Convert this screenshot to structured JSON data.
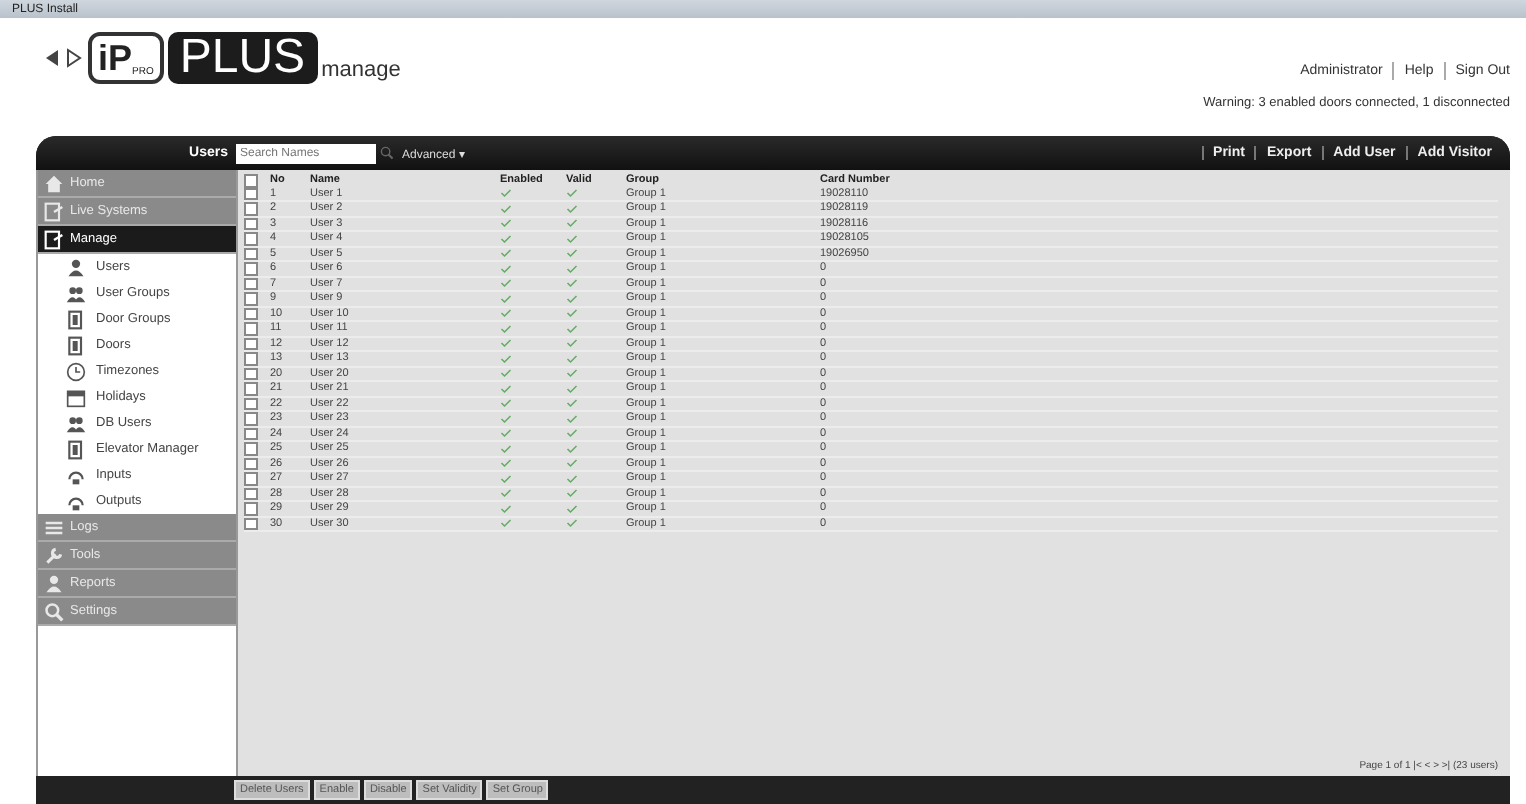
{
  "window": {
    "title": "PLUS Install"
  },
  "header": {
    "logo_text": "PLUS",
    "logo_badge": "iP",
    "logo_sub": "PRO",
    "app_name": "manage",
    "links": [
      "Administrator",
      "Help",
      "Sign Out"
    ],
    "warning": "Warning: 3 enabled doors connected, 1 disconnected"
  },
  "toolbar": {
    "section": "Users",
    "search": {
      "placeholder": "Search Names"
    },
    "advanced": "Advanced ▾",
    "actions": [
      "Print",
      "Export",
      "Add User",
      "Add Visitor"
    ]
  },
  "sidebar": {
    "items": [
      {
        "label": "Home",
        "selected": false
      },
      {
        "label": "Live Systems",
        "selected": false
      },
      {
        "label": "Manage",
        "selected": true,
        "children": [
          {
            "label": "Users"
          },
          {
            "label": "User Groups"
          },
          {
            "label": "Door Groups"
          },
          {
            "label": "Doors"
          },
          {
            "label": "Timezones"
          },
          {
            "label": "Holidays"
          },
          {
            "label": "DB Users"
          },
          {
            "label": "Elevator Manager"
          },
          {
            "label": "Inputs"
          },
          {
            "label": "Outputs"
          }
        ]
      },
      {
        "label": "Logs",
        "selected": false
      },
      {
        "label": "Tools",
        "selected": false
      },
      {
        "label": "Reports",
        "selected": false
      },
      {
        "label": "Settings",
        "selected": false
      }
    ]
  },
  "table": {
    "select_all_checked": false,
    "columns": [
      "No",
      "Name",
      "Enabled",
      "Valid",
      "Group",
      "Card Number"
    ],
    "rows": [
      {
        "no": "1",
        "name": "User 1",
        "enabled": true,
        "valid": true,
        "group": "Group 1",
        "card": "19028110",
        "checked": false
      },
      {
        "no": "2",
        "name": "User 2",
        "enabled": true,
        "valid": true,
        "group": "Group 1",
        "card": "19028119",
        "checked": false
      },
      {
        "no": "3",
        "name": "User 3",
        "enabled": true,
        "valid": true,
        "group": "Group 1",
        "card": "19028116",
        "checked": false
      },
      {
        "no": "4",
        "name": "User 4",
        "enabled": true,
        "valid": true,
        "group": "Group 1",
        "card": "19028105",
        "checked": false
      },
      {
        "no": "5",
        "name": "User 5",
        "enabled": true,
        "valid": true,
        "group": "Group 1",
        "card": "19026950",
        "checked": false
      },
      {
        "no": "6",
        "name": "User 6",
        "enabled": true,
        "valid": true,
        "group": "Group 1",
        "card": "0",
        "checked": false
      },
      {
        "no": "7",
        "name": "User 7",
        "enabled": true,
        "valid": true,
        "group": "Group 1",
        "card": "0",
        "checked": false
      },
      {
        "no": "9",
        "name": "User 9",
        "enabled": true,
        "valid": true,
        "group": "Group 1",
        "card": "0",
        "checked": false
      },
      {
        "no": "10",
        "name": "User 10",
        "enabled": true,
        "valid": true,
        "group": "Group 1",
        "card": "0",
        "checked": false
      },
      {
        "no": "11",
        "name": "User 11",
        "enabled": true,
        "valid": true,
        "group": "Group 1",
        "card": "0",
        "checked": false
      },
      {
        "no": "12",
        "name": "User 12",
        "enabled": true,
        "valid": true,
        "group": "Group 1",
        "card": "0",
        "checked": false
      },
      {
        "no": "13",
        "name": "User 13",
        "enabled": true,
        "valid": true,
        "group": "Group 1",
        "card": "0",
        "checked": false
      },
      {
        "no": "20",
        "name": "User 20",
        "enabled": true,
        "valid": true,
        "group": "Group 1",
        "card": "0",
        "checked": false
      },
      {
        "no": "21",
        "name": "User 21",
        "enabled": true,
        "valid": true,
        "group": "Group 1",
        "card": "0",
        "checked": false
      },
      {
        "no": "22",
        "name": "User 22",
        "enabled": true,
        "valid": true,
        "group": "Group 1",
        "card": "0",
        "checked": false
      },
      {
        "no": "23",
        "name": "User 23",
        "enabled": true,
        "valid": true,
        "group": "Group 1",
        "card": "0",
        "checked": false
      },
      {
        "no": "24",
        "name": "User 24",
        "enabled": true,
        "valid": true,
        "group": "Group 1",
        "card": "0",
        "checked": false
      },
      {
        "no": "25",
        "name": "User 25",
        "enabled": true,
        "valid": true,
        "group": "Group 1",
        "card": "0",
        "checked": false
      },
      {
        "no": "26",
        "name": "User 26",
        "enabled": true,
        "valid": true,
        "group": "Group 1",
        "card": "0",
        "checked": false
      },
      {
        "no": "27",
        "name": "User 27",
        "enabled": true,
        "valid": true,
        "group": "Group 1",
        "card": "0",
        "checked": false
      },
      {
        "no": "28",
        "name": "User 28",
        "enabled": true,
        "valid": true,
        "group": "Group 1",
        "card": "0",
        "checked": false
      },
      {
        "no": "29",
        "name": "User 29",
        "enabled": true,
        "valid": true,
        "group": "Group 1",
        "card": "0",
        "checked": false
      },
      {
        "no": "30",
        "name": "User 30",
        "enabled": true,
        "valid": true,
        "group": "Group 1",
        "card": "0",
        "checked": false
      }
    ]
  },
  "pagination": "Page 1 of 1  |< < > >|  (23 users)",
  "bottom_buttons": [
    "Delete Users",
    "Enable",
    "Disable",
    "Set Validity",
    "Set Group"
  ]
}
